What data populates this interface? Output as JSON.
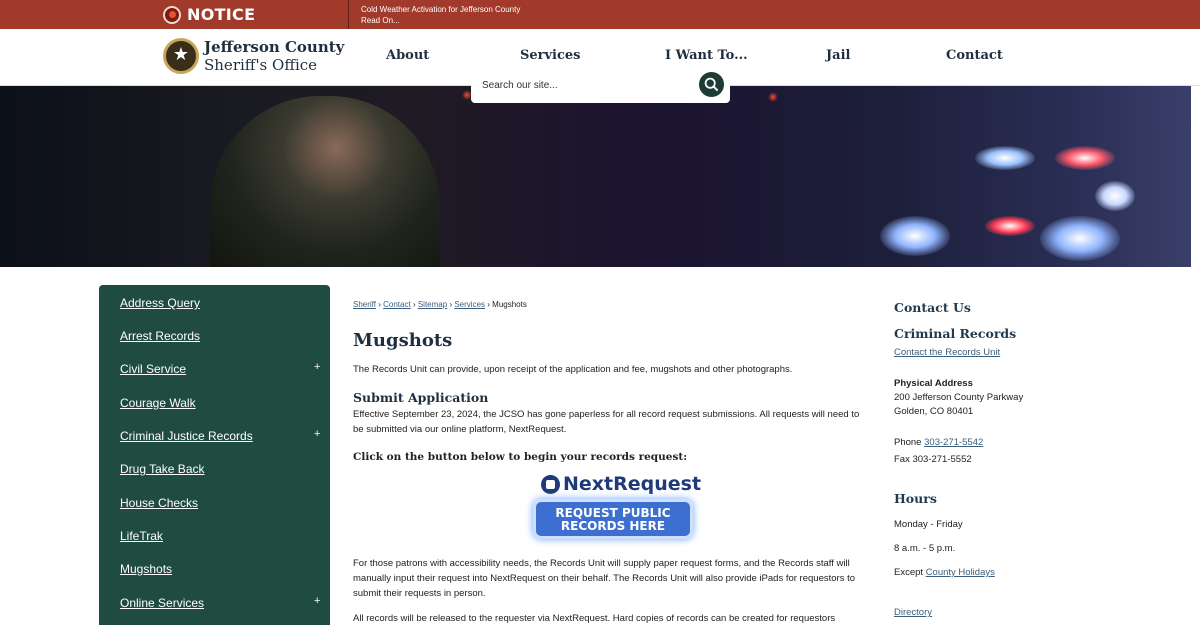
{
  "notice": {
    "title": "NOTICE",
    "message": "Cold Weather Activation for Jefferson County",
    "read_more": "Read On..."
  },
  "header": {
    "logo_line1": "Jefferson County",
    "logo_line2": "Sheriff's Office",
    "nav": [
      "About",
      "Services",
      "I Want To...",
      "Jail",
      "Contact"
    ]
  },
  "search": {
    "placeholder": "Search our site..."
  },
  "sidebar": {
    "items": [
      {
        "label": "Address Query",
        "expandable": false
      },
      {
        "label": "Arrest Records",
        "expandable": false
      },
      {
        "label": "Civil Service",
        "expandable": true
      },
      {
        "label": "Courage Walk",
        "expandable": false
      },
      {
        "label": "Criminal Justice Records",
        "expandable": true
      },
      {
        "label": "Drug Take Back",
        "expandable": false
      },
      {
        "label": "House Checks",
        "expandable": false
      },
      {
        "label": "LifeTrak",
        "expandable": false
      },
      {
        "label": "Mugshots",
        "expandable": false
      },
      {
        "label": "Online Services",
        "expandable": true
      }
    ],
    "plus": "+"
  },
  "breadcrumb": {
    "items": [
      "Sheriff",
      "Contact",
      "Sitemap",
      "Services"
    ],
    "current": "Mugshots",
    "separator": "›"
  },
  "main": {
    "title": "Mugshots",
    "intro": "The Records Unit can provide, upon receipt of the application and fee, mugshots and other photographs.",
    "submit_heading": "Submit Application",
    "submit_text": "Effective September 23, 2024, the JCSO has gone paperless for all record request submissions. All requests will need to be submitted via our online platform, NextRequest.",
    "click_heading": "Click on the button below to begin your records request:",
    "nextrequest_logo": "NextRequest",
    "request_button_line1": "REQUEST PUBLIC",
    "request_button_line2": "RECORDS HERE",
    "accessibility_text": "For those patrons with accessibility needs, the Records Unit will supply paper request forms, and the Records staff will manually input their request into NextRequest on their behalf. The Records Unit will also provide iPads for requestors to submit their requests in person.",
    "bottom_text": "All records will be released to the requester via NextRequest. Hard copies of records can be created for requestors"
  },
  "contact": {
    "heading": "Contact Us",
    "dept": "Criminal Records",
    "dept_link": "Contact the Records Unit",
    "address_label": "Physical Address",
    "address_line1": "200 Jefferson County Parkway",
    "address_line2": "Golden, CO 80401",
    "phone_label": "Phone",
    "phone": "303-271-5542",
    "fax": "Fax 303-271-5552",
    "hours_heading": "Hours",
    "days": "Monday - Friday",
    "hours": "8 a.m. - 5 p.m.",
    "except_label": "Except",
    "holidays_link": "County Holidays",
    "directory_link": "Directory"
  },
  "colors": {
    "notice_bg": "#a23a2b",
    "sidebar_bg": "#1f4b40",
    "heading": "#1f2f3f",
    "link": "#3b5e7d",
    "nextrequest_blue": "#3c6fd0"
  }
}
